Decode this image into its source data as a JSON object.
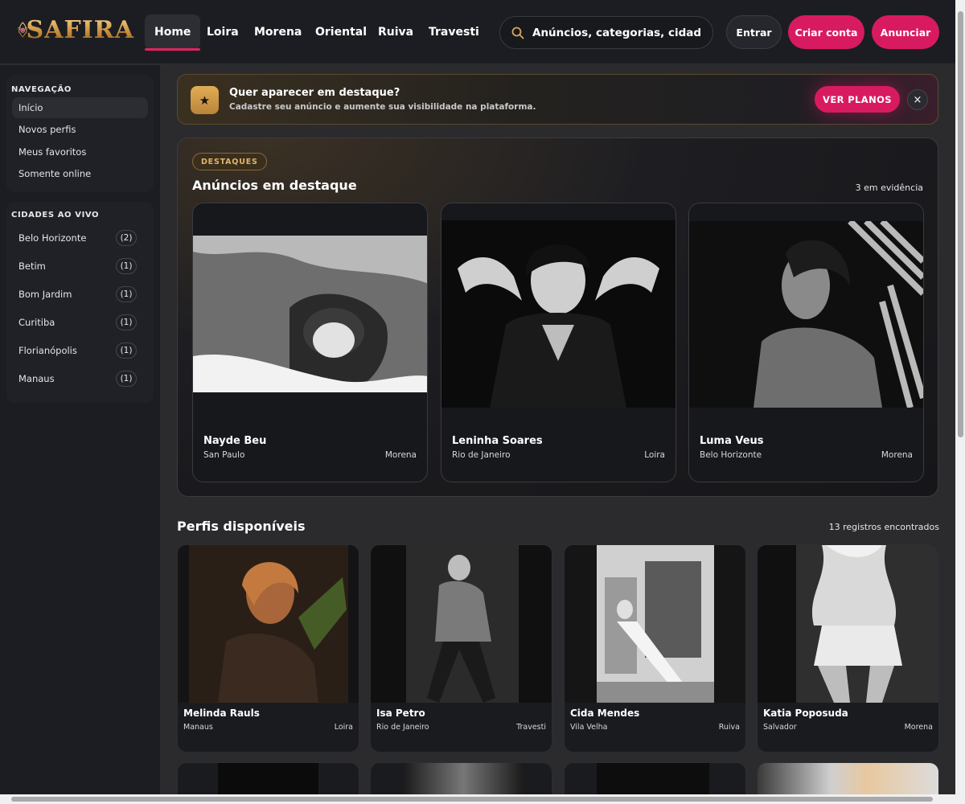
{
  "brand": {
    "name": "SAFIRA"
  },
  "nav": {
    "tabs": [
      "Home",
      "Loira",
      "Morena",
      "Oriental",
      "Ruiva",
      "Travesti"
    ],
    "active": "Home"
  },
  "search": {
    "placeholder": "Anúncios, categorias, cidades..."
  },
  "header_buttons": {
    "login": "Entrar",
    "register": "Criar conta",
    "advertise": "Anunciar"
  },
  "sidebar": {
    "nav_heading": "NAVEGAÇÃO",
    "nav_items": [
      "Início",
      "Novos perfis",
      "Meus favoritos",
      "Somente online"
    ],
    "cities_heading": "CIDADES AO VIVO",
    "cities": [
      {
        "name": "Belo Horizonte",
        "count": "(2)"
      },
      {
        "name": "Betim",
        "count": "(1)"
      },
      {
        "name": "Bom Jardim",
        "count": "(1)"
      },
      {
        "name": "Curitiba",
        "count": "(1)"
      },
      {
        "name": "Florianópolis",
        "count": "(1)"
      },
      {
        "name": "Manaus",
        "count": "(1)"
      }
    ]
  },
  "promo": {
    "title": "Quer aparecer em destaque?",
    "subtitle": "Cadastre seu anúncio e aumente sua visibilidade na plataforma.",
    "button": "VER PLANOS",
    "close": "×",
    "star": "★"
  },
  "featured": {
    "badge": "DESTAQUES",
    "title": "Anúncios em destaque",
    "count": "3 em evidência",
    "cards": [
      {
        "name": "Nayde Beu",
        "city": "San Paulo",
        "category": "Morena"
      },
      {
        "name": "Leninha Soares",
        "city": "Rio de Janeiro",
        "category": "Loira"
      },
      {
        "name": "Luma Veus",
        "city": "Belo Horizonte",
        "category": "Morena"
      }
    ]
  },
  "profiles": {
    "title": "Perfis disponíveis",
    "count": "13 registros encontrados",
    "cards": [
      {
        "name": "Melinda Rauls",
        "city": "Manaus",
        "category": "Loira"
      },
      {
        "name": "Isa Petro",
        "city": "Rio de Janeiro",
        "category": "Travesti"
      },
      {
        "name": "Cida Mendes",
        "city": "Vila Velha",
        "category": "Ruiva"
      },
      {
        "name": "Katia Poposuda",
        "city": "Salvador",
        "category": "Morena"
      }
    ]
  },
  "colors": {
    "accent": "#d81b60",
    "gold": "#d9a65a",
    "background": "#2b2b2e",
    "panel": "#1c1d22"
  },
  "icons": [
    "gem-logo-icon",
    "search-icon",
    "star-icon",
    "close-icon"
  ]
}
